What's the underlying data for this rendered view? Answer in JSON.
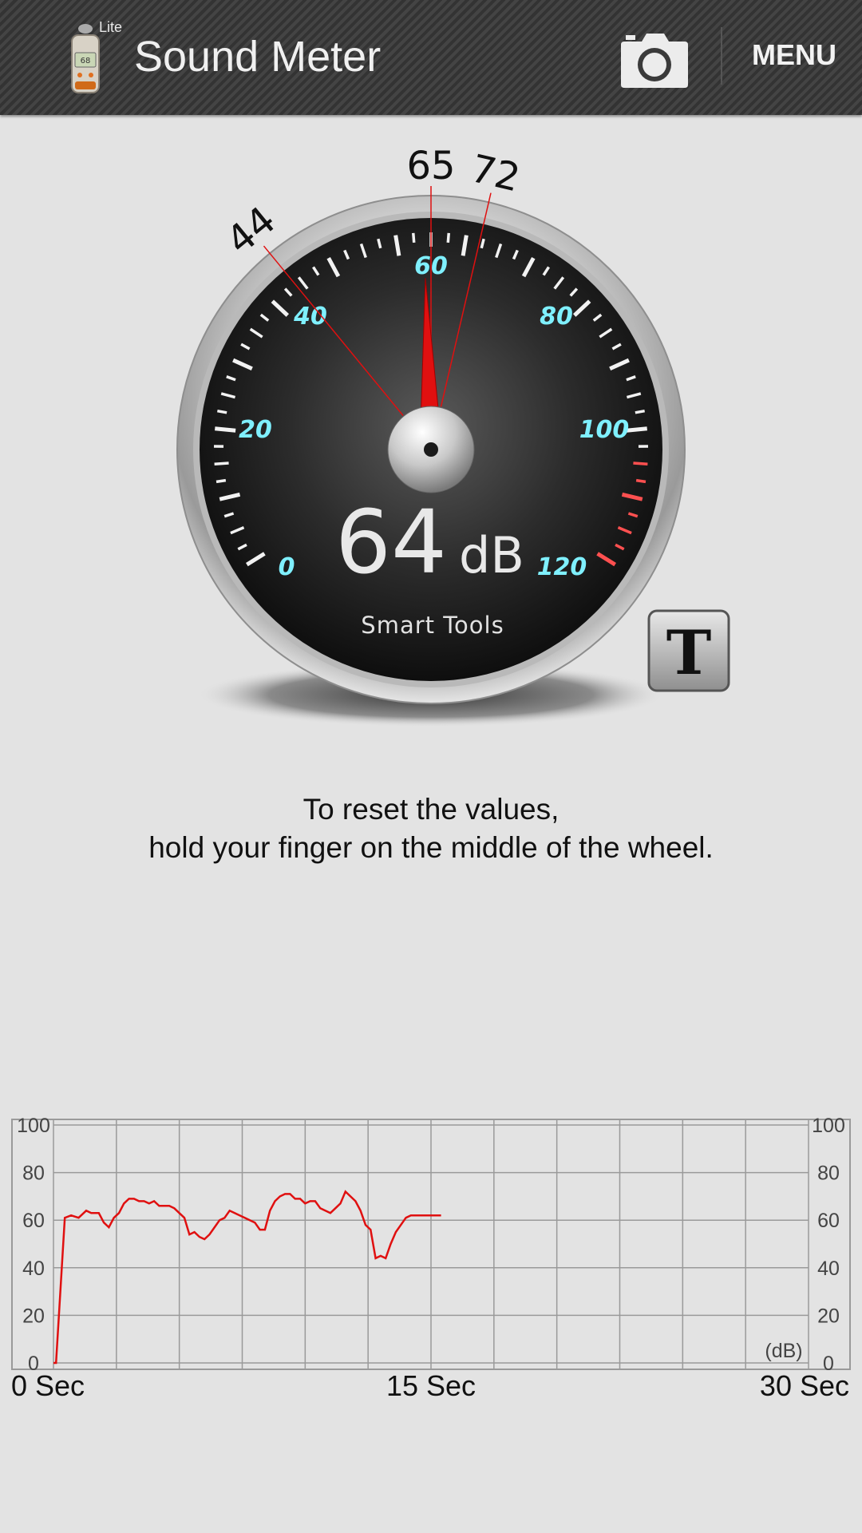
{
  "app": {
    "title": "Sound Meter",
    "badge": "Lite",
    "menu_label": "MENU",
    "camera_icon": "camera-icon"
  },
  "gauge": {
    "scale_labels": [
      "0",
      "20",
      "40",
      "60",
      "80",
      "100",
      "120"
    ],
    "reading": "64",
    "unit": "dB",
    "brand": "Smart Tools",
    "min_marker": "44",
    "avg_marker": "65",
    "max_marker": "72",
    "needle_value": 64,
    "min_value": 44,
    "avg_value": 65,
    "max_value": 72,
    "accent_color": "#7ff0ff",
    "needle_color": "#e01010"
  },
  "t_button_label": "T",
  "instruction": {
    "line1": "To reset the values,",
    "line2": "hold your finger on the middle of the wheel."
  },
  "chart_data": {
    "type": "line",
    "x_labels": [
      "0 Sec",
      "15 Sec",
      "30 Sec"
    ],
    "y_ticks": [
      "100",
      "80",
      "60",
      "40",
      "20",
      "0"
    ],
    "unit_label": "(dB)",
    "xlim": [
      0,
      30
    ],
    "ylim": [
      0,
      100
    ],
    "grid": true,
    "line_color": "#e01010",
    "series": [
      {
        "x": [
          0.0,
          0.1,
          0.45,
          0.7,
          1.0,
          1.3,
          1.5,
          1.8,
          2.0,
          2.2,
          2.4,
          2.6,
          2.8,
          3.0,
          3.2,
          3.4,
          3.6,
          3.8,
          4.0,
          4.2,
          4.4,
          4.6,
          4.8,
          5.0,
          5.2,
          5.4,
          5.6,
          5.8,
          6.0,
          6.2,
          6.4,
          6.6,
          6.8,
          7.0,
          7.2,
          7.4,
          7.6,
          7.8,
          8.0,
          8.2,
          8.4,
          8.6,
          8.8,
          9.0,
          9.2,
          9.4,
          9.6,
          9.8,
          10.0,
          10.2,
          10.4,
          10.6,
          10.8,
          11.0,
          11.2,
          11.4,
          11.6,
          11.8,
          12.0,
          12.2,
          12.4,
          12.6,
          12.8,
          13.0,
          13.2,
          13.4,
          13.6,
          13.8,
          14.0,
          14.2,
          14.4,
          14.6,
          14.8,
          15.0,
          15.2,
          15.4
        ],
        "y": [
          0,
          0,
          61,
          62,
          61,
          64,
          63,
          63,
          59,
          57,
          61,
          63,
          67,
          69,
          69,
          68,
          68,
          67,
          68,
          66,
          66,
          66,
          65,
          63,
          61,
          54,
          55,
          53,
          52,
          54,
          57,
          60,
          61,
          64,
          63,
          62,
          61,
          60,
          59,
          56,
          56,
          64,
          68,
          70,
          71,
          71,
          69,
          69,
          67,
          68,
          68,
          65,
          64,
          63,
          65,
          67,
          72,
          70,
          68,
          64,
          58,
          56,
          44,
          45,
          44,
          50,
          55,
          58,
          61,
          62,
          62,
          62,
          62,
          62,
          62,
          62
        ]
      }
    ]
  }
}
